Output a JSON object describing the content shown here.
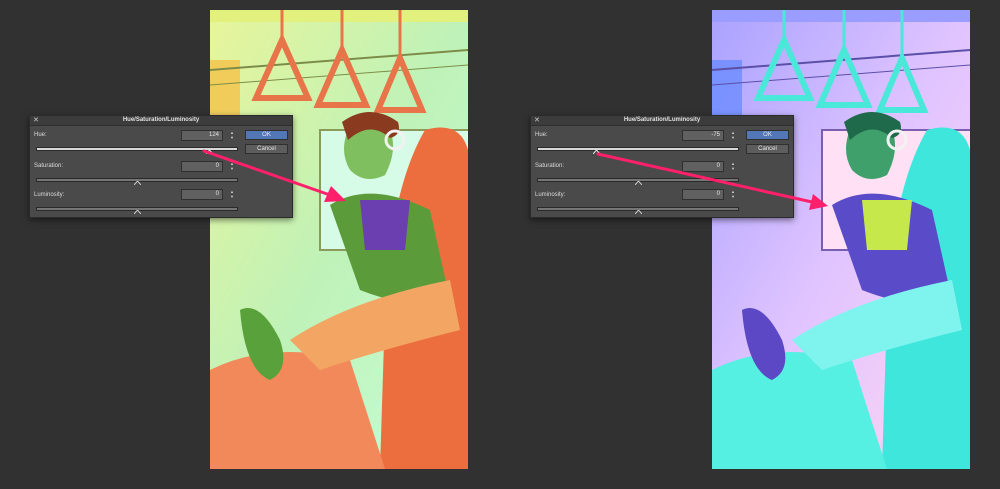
{
  "dialogs": [
    {
      "title": "Hue/Saturation/Luminosity",
      "close_glyph": "✕",
      "hue_label": "Hue:",
      "hue_value": "124",
      "saturation_label": "Saturation:",
      "saturation_value": "0",
      "luminosity_label": "Luminosity:",
      "luminosity_value": "0",
      "ok_label": "OK",
      "cancel_label": "Cancel",
      "hue_slider_position": 0.86,
      "saturation_slider_position": 0.5,
      "luminosity_slider_position": 0.5
    },
    {
      "title": "Hue/Saturation/Luminosity",
      "close_glyph": "✕",
      "hue_label": "Hue:",
      "hue_value": "-75",
      "saturation_label": "Saturation:",
      "saturation_value": "0",
      "luminosity_label": "Luminosity:",
      "luminosity_value": "0",
      "ok_label": "OK",
      "cancel_label": "Cancel",
      "hue_slider_position": 0.29,
      "saturation_slider_position": 0.5,
      "luminosity_slider_position": 0.5
    }
  ],
  "artworks": [
    {
      "name": "hue-shifted-illustration-plus-124",
      "hue_shift": "124"
    },
    {
      "name": "hue-shifted-illustration-minus-75",
      "hue_shift": "-75"
    }
  ],
  "colors": {
    "background": "#313131",
    "dialog_bg": "#4a4a4a",
    "ok_button": "#5277b6",
    "arrow": "#ff1f6b",
    "left_art_bg": "#bff2a8",
    "left_art_accent": "#f07a47",
    "right_art_bg": "#c9b3ff",
    "right_art_accent": "#4ff0e6"
  },
  "icons": {
    "close": "close-icon",
    "spinner": "spinner-arrows-icon",
    "slider_thumb": "slider-thumb-icon",
    "annotation": "pink-arrow-icon"
  }
}
